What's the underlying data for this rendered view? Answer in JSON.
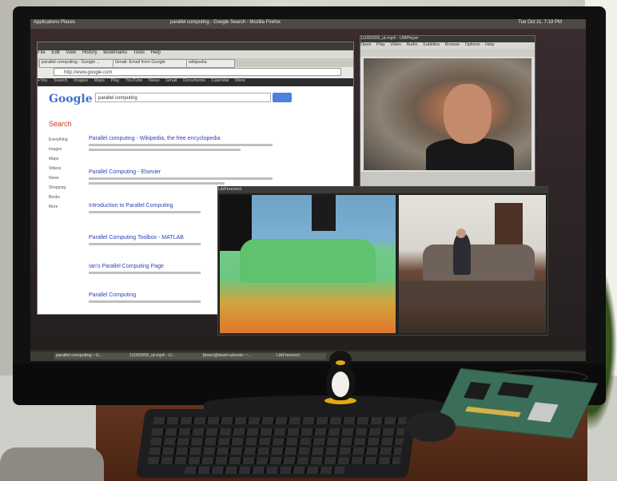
{
  "ubuntu_panel": {
    "menu": "Applications  Places",
    "firefox_title": "parallel computing - Google Search - Mozilla Firefox",
    "clock": "Tue Oct 11, 7:19 PM"
  },
  "firefox": {
    "menu": [
      "File",
      "Edit",
      "View",
      "History",
      "Bookmarks",
      "Tools",
      "Help"
    ],
    "tabs": [
      "parallel computing - Google ...",
      "Gmail: Email from Google",
      "wikipedia"
    ],
    "url": "http://www.google.com",
    "google_bar": [
      "+You",
      "Search",
      "Images",
      "Maps",
      "Play",
      "YouTube",
      "News",
      "Gmail",
      "Documents",
      "Calendar",
      "More"
    ],
    "logo": "Google",
    "query": "parallel computing",
    "side_heading": "Search",
    "side_items": [
      "Everything",
      "Images",
      "Maps",
      "Videos",
      "News",
      "Shopping",
      "Books",
      "More"
    ],
    "results": [
      "Parallel computing - Wikipedia, the free encyclopedia",
      "Parallel Computing - Elsevier",
      "Introduction to Parallel Computing",
      "Parallel Computing Toolbox - MATLAB",
      "Ian's Parallel Computing Page",
      "Parallel Computing"
    ]
  },
  "player": {
    "title": "11092009_ut.mp4 - UMPlayer",
    "menu": [
      "Open",
      "Play",
      "Video",
      "Audio",
      "Subtitles",
      "Browse",
      "Options",
      "Help"
    ]
  },
  "kinect": {
    "title": "LibFreenect"
  },
  "taskbar": {
    "items": [
      "parallel computing - G...",
      "11092009_ut.mp4 - U...",
      "[team@team-ubuntu: ~...",
      "LibFreenect"
    ]
  },
  "colors": {
    "depth_sky": "#6fa4c8",
    "depth_green": "#5fc26e",
    "depth_orange": "#e0772c",
    "pcb_green": "#3b6e58"
  }
}
